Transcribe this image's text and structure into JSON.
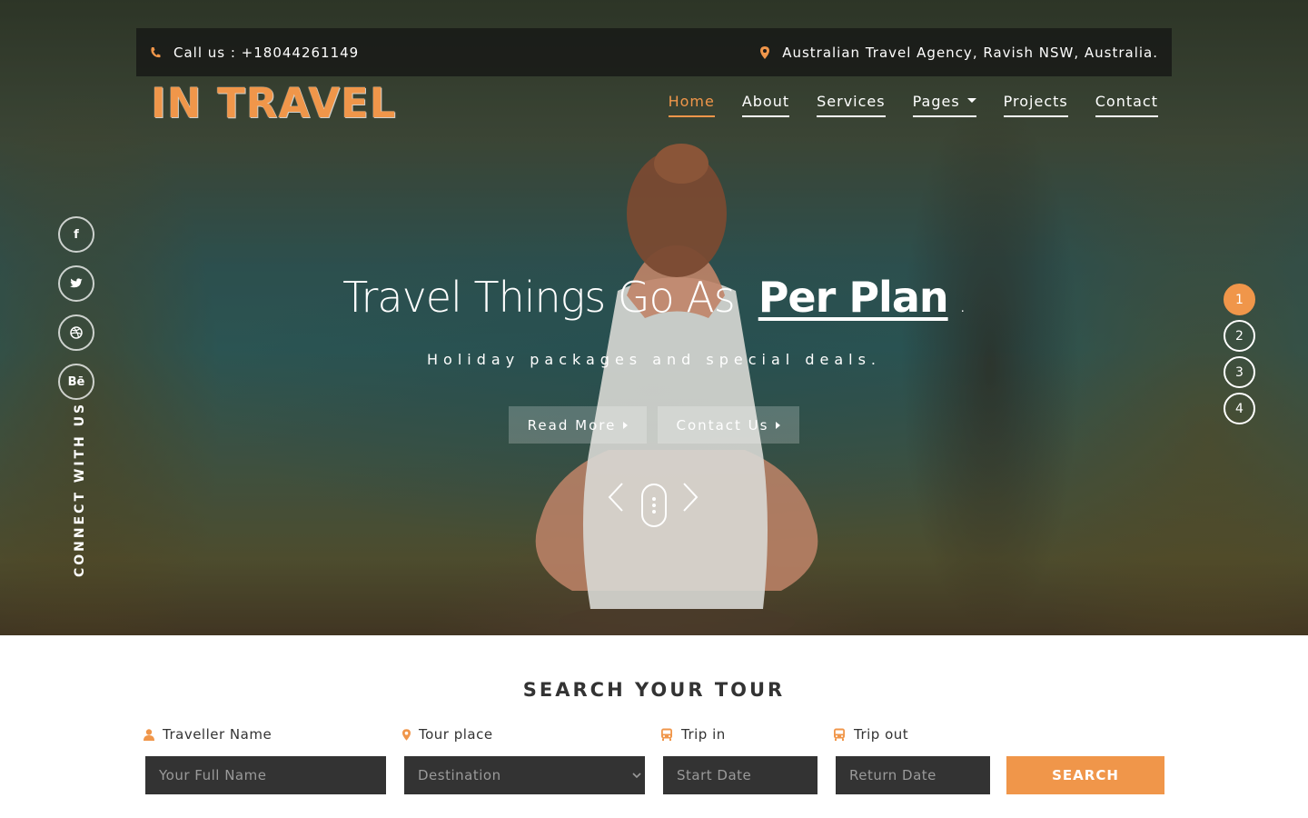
{
  "colors": {
    "accent": "#f0964a",
    "field_bg": "#333333",
    "topbar_bg": "rgba(20,20,20,0.72)"
  },
  "topbar": {
    "phone_icon": "phone-icon",
    "phone_text": "Call us : +18044261149",
    "location_icon": "map-marker-icon",
    "address_text": "Australian Travel Agency, Ravish NSW, Australia."
  },
  "logo": {
    "text": "IN TRAVEL"
  },
  "nav": {
    "items": [
      {
        "label": "Home",
        "active": true
      },
      {
        "label": "About"
      },
      {
        "label": "Services"
      },
      {
        "label": "Pages",
        "dropdown": true
      },
      {
        "label": "Projects"
      },
      {
        "label": "Contact"
      }
    ]
  },
  "social": {
    "items": [
      {
        "icon": "facebook-icon",
        "glyph": "f"
      },
      {
        "icon": "twitter-icon",
        "glyph": ""
      },
      {
        "icon": "dribbble-icon",
        "glyph": ""
      },
      {
        "icon": "behance-icon",
        "glyph": "Bē"
      }
    ],
    "connect_label": "CONNECT WITH US"
  },
  "hero": {
    "headline_prefix": "Travel Things Go As",
    "headline_emphasis": "Per Plan",
    "headline_suffix": ".",
    "subtitle": "Holiday packages and special deals.",
    "read_more": "Read More",
    "contact_us": "Contact Us",
    "prev_icon": "chevron-left-icon",
    "next_icon": "chevron-right-icon",
    "scroll_icon": "scroll-indicator-icon"
  },
  "pager": {
    "pages": [
      "1",
      "2",
      "3",
      "4"
    ],
    "active": "1"
  },
  "search": {
    "title": "SEARCH YOUR TOUR",
    "traveller_label": "Traveller Name",
    "traveller_icon": "user-icon",
    "traveller_placeholder": "Your Full Name",
    "place_label": "Tour place",
    "place_icon": "map-marker-icon",
    "place_selected": "Destination",
    "tripin_label": "Trip in",
    "tripin_icon": "bus-icon",
    "tripin_placeholder": "Start Date",
    "tripout_label": "Trip out",
    "tripout_icon": "bus-icon",
    "tripout_placeholder": "Return Date",
    "button": "SEARCH"
  }
}
